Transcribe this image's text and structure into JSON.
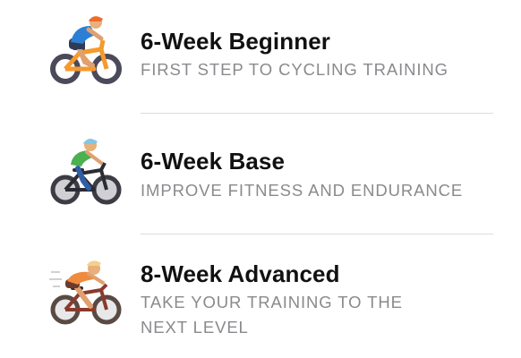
{
  "plans": [
    {
      "title": "6-Week Beginner",
      "subtitle": "FIRST STEP TO CYCLING TRAINING",
      "icon": "beginner-cyclist-icon"
    },
    {
      "title": "6-Week Base",
      "subtitle": "IMPROVE FITNESS AND ENDURANCE",
      "icon": "base-cyclist-icon"
    },
    {
      "title": "8-Week Advanced",
      "subtitle": "TAKE YOUR TRAINING TO THE NEXT LEVEL",
      "icon": "advanced-cyclist-icon"
    }
  ],
  "colors": {
    "title": "#111111",
    "subtitle": "#8a8a8e",
    "divider": "#dcdcdf",
    "beginner_bike": "#f59a2c",
    "base_jersey": "#4caf50",
    "advanced_jersey": "#f08a3c"
  }
}
